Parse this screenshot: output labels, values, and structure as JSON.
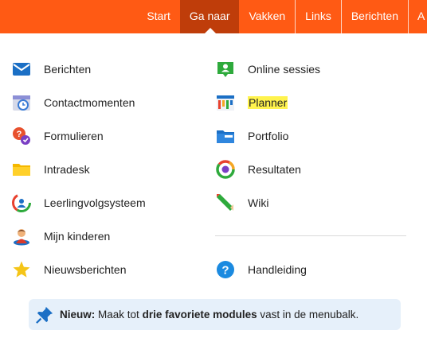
{
  "nav": {
    "items": [
      "Start",
      "Ga naar",
      "Vakken",
      "Links",
      "Berichten",
      "A"
    ],
    "active": "Ga naar",
    "accent": "#ff5a14",
    "active_color": "#bf3d0a"
  },
  "menu": {
    "left": [
      {
        "label": "Berichten",
        "icon": "envelope-icon"
      },
      {
        "label": "Contactmomenten",
        "icon": "calendar-clock-icon"
      },
      {
        "label": "Formulieren",
        "icon": "form-bubbles-icon"
      },
      {
        "label": "Intradesk",
        "icon": "folder-icon"
      },
      {
        "label": "Leerlingvolgsysteem",
        "icon": "student-tracking-icon"
      },
      {
        "label": "Mijn kinderen",
        "icon": "child-icon"
      },
      {
        "label": "Nieuwsberichten",
        "icon": "star-icon"
      }
    ],
    "right": [
      {
        "label": "Online sessies",
        "icon": "online-session-icon"
      },
      {
        "label": "Planner",
        "icon": "planner-icon",
        "highlight": true
      },
      {
        "label": "Portfolio",
        "icon": "portfolio-folder-icon"
      },
      {
        "label": "Resultaten",
        "icon": "results-ring-icon"
      },
      {
        "label": "Wiki",
        "icon": "pencil-icon"
      },
      {
        "label": "Handleiding",
        "icon": "help-icon"
      }
    ]
  },
  "tip": {
    "icon": "pin-icon",
    "prefix": "Nieuw:",
    "text_before": "Maak tot",
    "bold_text": "drie favoriete modules",
    "text_after": "vast in de menubalk."
  }
}
